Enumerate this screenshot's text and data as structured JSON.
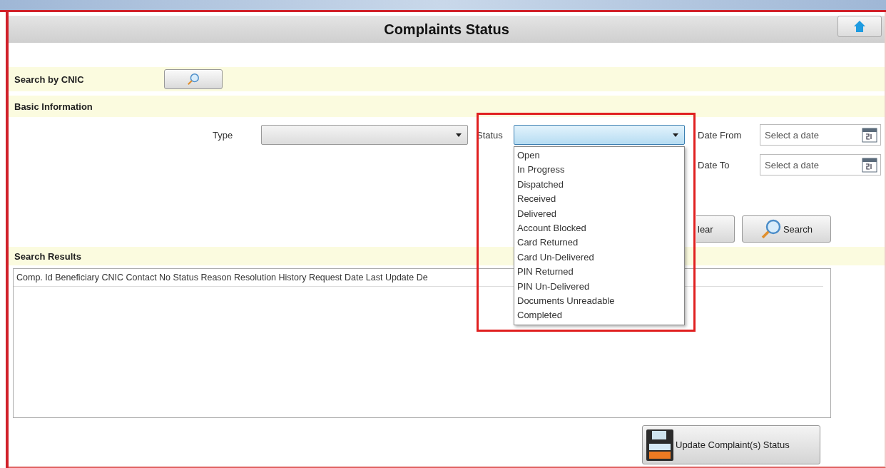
{
  "window": {
    "title": "Complaints Status"
  },
  "search_by_cnic": {
    "label": "Search by CNIC"
  },
  "basic_information": {
    "label": "Basic Information",
    "type_label": "Type",
    "status_label": "Status",
    "status_expanded": true,
    "status_options": [
      "Open",
      "In Progress",
      "Dispatched",
      "Received",
      "Delivered",
      "Account Blocked",
      "Card Returned",
      "Card Un-Delivered",
      "PIN Returned",
      "PIN Un-Delivered",
      "Documents Unreadable",
      "Completed"
    ],
    "date_from_label": "Date From",
    "date_from_placeholder": "Select a date",
    "date_to_label": "Date To",
    "date_to_placeholder": "Select a date"
  },
  "buttons": {
    "clear": "lear",
    "search": "Search"
  },
  "search_results": {
    "label": "Search Results",
    "header": "Comp. Id Beneficiary CNIC Contact No Status Reason Resolution History Request Date Last Update De"
  },
  "update_button": "Update Complaint(s) Status"
}
